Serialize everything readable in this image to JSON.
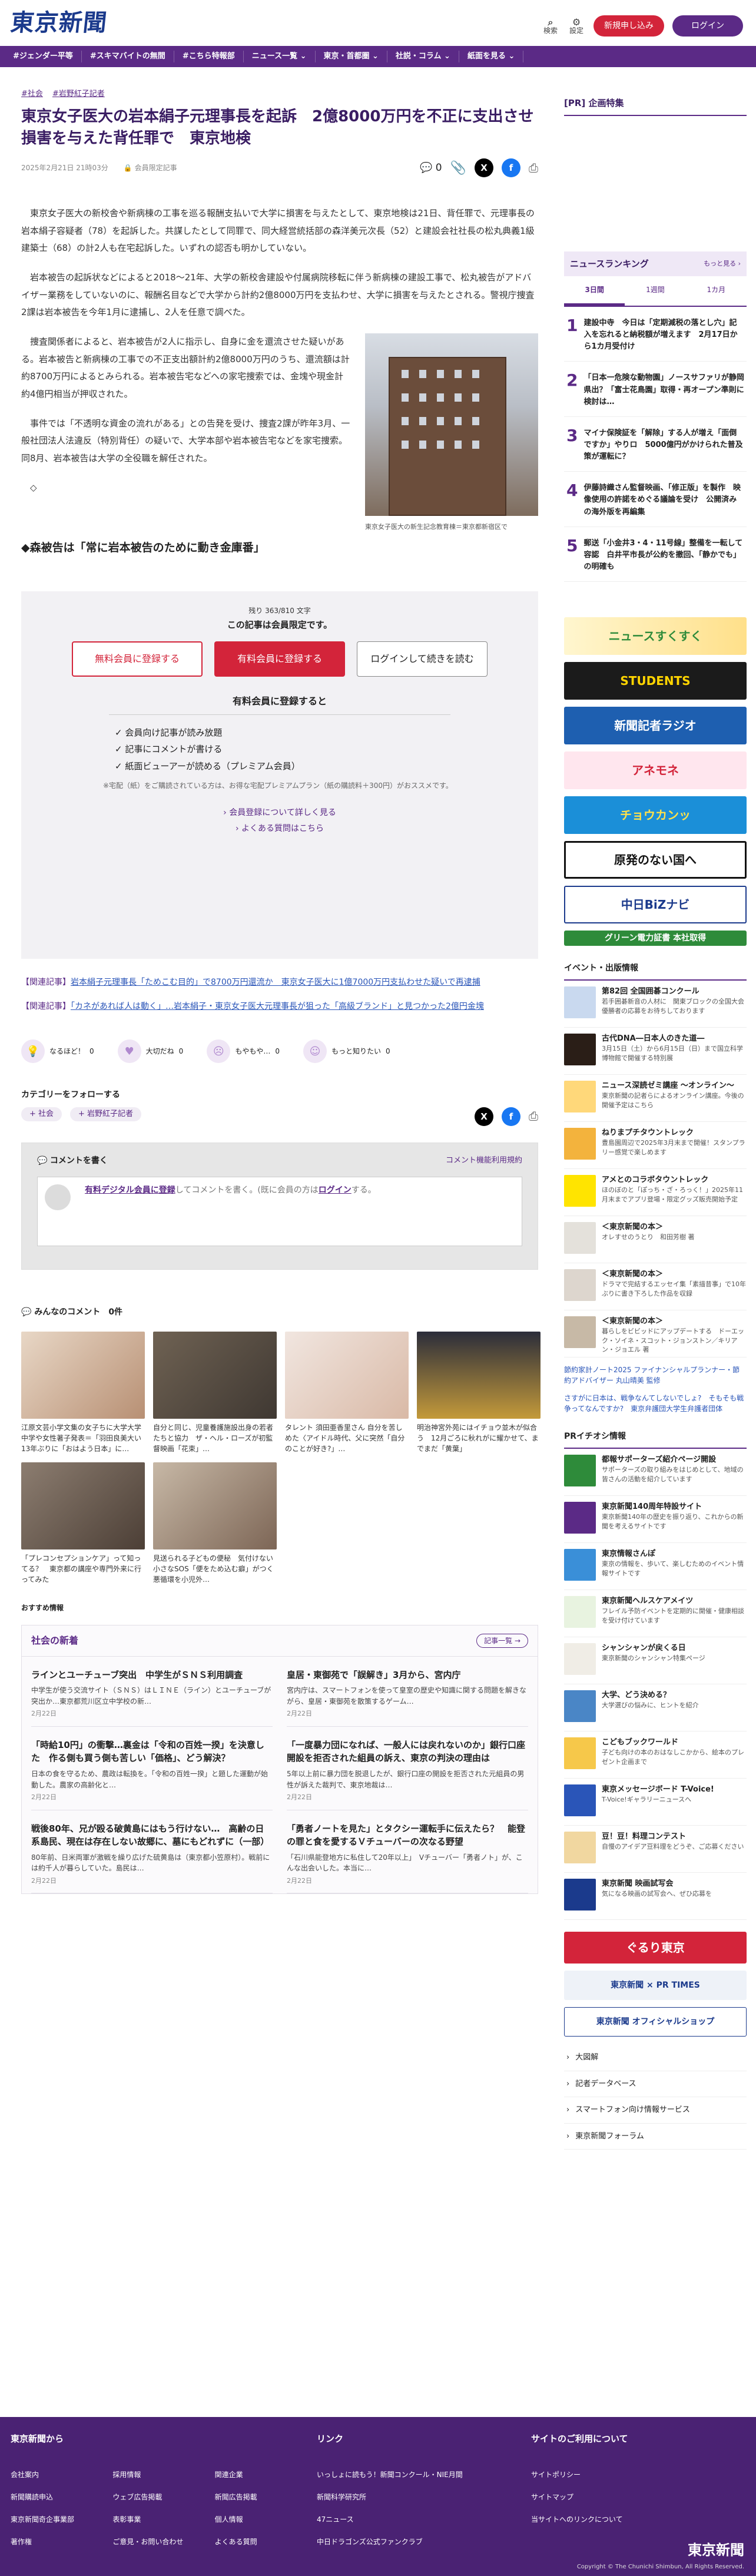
{
  "header": {
    "logo": "東京新聞",
    "search": "検索",
    "settings": "設定",
    "register": "新規申し込み",
    "login": "ログイン"
  },
  "nav": [
    "#ジェンダー平等",
    "#スキマバイトの無間",
    "#こちら特報部",
    "ニュース一覧 ⌄",
    "東京・首都圏 ⌄",
    "社説・コラム ⌄",
    "紙面を見る ⌄"
  ],
  "article": {
    "tags": [
      "#社会",
      "#岩野紅子記者"
    ],
    "title": "東京女子医大の岩本絹子元理事長を起訴　2億8000万円を不正に支出させ損害を与えた背任罪で　東京地検",
    "date": "2025年2月21日 21時03分",
    "author": "会員限定記事",
    "comment_count": "0",
    "paragraphs": [
      "東京女子医大の新校舎や新病棟の工事を巡る報酬支払いで大学に損害を与えたとして、東京地検は21日、背任罪で、元理事長の岩本絹子容疑者（78）を起訴した。共謀したとして同罪で、同大経営統括部の森洋美元次長（52）と建設会社社長の松丸典義1級建築士（68）の計2人も在宅起訴した。いずれの認否も明かしていない。",
      "岩本被告の起訴状などによると2018～21年、大学の新校舎建設や付属病院移転に伴う新病棟の建設工事で、松丸被告がアドバイザー業務をしていないのに、報酬名目などで大学から計約2億8000万円を支払わせ、大学に損害を与えたとされる。警視庁捜査2課は岩本被告を今年1月に逮捕し、2人を任意で調べた。",
      "捜査関係者によると、岩本被告が2人に指示し、自身に金を還流させた疑いがある。岩本被告と新病棟の工事での不正支出額計約2億8000万円のうち、還流額は計約8700万円によるとみられる。岩本被告宅などへの家宅捜索では、金塊や現金計約4億円相当が押収された。",
      "事件では「不透明な資金の流れがある」との告発を受け、捜査2課が昨年3月、一般社団法人法違反（特別背任）の疑いで、大学本部や岩本被告宅などを家宅捜索。同8月、岩本被告は大学の全役職を解任された。",
      "◇"
    ],
    "photo_caption": "東京女子医大の新生記念教育棟＝東京都新宿区で",
    "subheading": "◆森被告は「常に岩本被告のために動き金庫番」"
  },
  "paywall": {
    "remaining": "残り 363/810 文字",
    "notice": "この記事は会員限定です。",
    "free": "無料会員に登録する",
    "paid": "有料会員に登録する",
    "login": "ログインして続きを読む",
    "benefit_title": "有料会員に登録すると",
    "benefits": [
      "✓ 会員向け記事が読み放題",
      "✓ 記事にコメントが書ける",
      "✓ 紙面ビューアーが読める（プレミアム会員）"
    ],
    "note": "※宅配（紙）をご購読されている方は、お得な宅配プレミアムプラン（紙の購読料＋300円）がおススメです。",
    "link1": "会員登録について詳しく見る",
    "link2": "よくある質問はこちら"
  },
  "related": [
    {
      "label": "【関連記事】",
      "text": "岩本絹子元理事長「ためこむ目的」で8700万円還流か　東京女子医大に1億7000万円支払わせた疑いで再逮捕"
    },
    {
      "label": "【関連記事】",
      "text": "「カネがあれば人は動く」…岩本絹子・東京女子医大元理事長が狙った「高級ブランド」と見つかった2億円金塊"
    }
  ],
  "reactions": [
    "なるほど！",
    "大切だね",
    "もやもや…",
    "もっと知りたい"
  ],
  "reaction_counts": [
    "0",
    "0",
    "0",
    "0"
  ],
  "category": {
    "title": "カテゴリーをフォローする",
    "chips": [
      "+ 社会",
      "+ 岩野紅子記者"
    ]
  },
  "comment": {
    "title": "コメントを書く",
    "rules": "コメント機能利用規約",
    "prompt_link": "有料デジタル会員に登録",
    "prompt_text": "してコメントを書く。(既に会員の方は",
    "login": "ログイン",
    "prompt_end": "する。"
  },
  "everyone": {
    "title": "みんなのコメント",
    "count": "0件"
  },
  "grid": [
    "江原文芸小学文集の女子ちに大学大学中学や女性著子発表＝「羽田良美大い　13年ぶりに「おはよう日本」に…",
    "自分と同じ、児童養護施設出身の若者たちと協力　ザ・ヘル・ローズが初監督映画「花束」…",
    "タレント 須田亜香里さん 自分を苦しめた〈アイドル時代、父に突然「自分のことが好き?」…",
    "明治神宮外苑にはイチョウ並木が似合う　12月ごろに秋れがに耀かせて、までまだ「黄葉」",
    "「プレコンセプションケア」って知ってる？　東京都の講座や専門外来に行ってみた",
    "見送られる子どもの便秘　気付けない小さなSOS「便をため込む癖」がつく悪循環を小児外…"
  ],
  "recommend": "おすすめ情報",
  "social": {
    "title": "社会の新着",
    "more": "記事一覧 →",
    "items": [
      {
        "t": "ラインとユーチューブ突出　中学生がＳＮＳ利用調査",
        "p": "中学生が使う交流サイト（ＳＮＳ）はＬＩＮＥ（ライン）とユーチューブが突出か…東京都荒川区立中学校の新…",
        "d": "2月22日"
      },
      {
        "t": "皇居・東御苑で「誤解き」3月から、宮内庁",
        "p": "宮内庁は、スマートフォンを使って皇室の歴史や知識に関する問題を解きながら、皇居・東御苑を散策するゲーム…",
        "d": "2月22日"
      },
      {
        "t": "「時給10円」の衝撃…裏金は「令和の百姓一揆」を決意した　作る側も買う側も苦しい「価格」、どう解決？",
        "p": "日本の食を守るため、農政は転換を。「令和の百姓一揆」と題した運動が始動した。農家の高齢化と…",
        "d": "2月22日"
      },
      {
        "t": "「一度暴力団になれば、一般人には戻れないのか」銀行口座開設を拒否された組員の訴え、東京の判決の理由は",
        "p": "5年以上前に暴力団を脱退したが、銀行口座の開設を拒否された元組員の男性が訴えた裁判で、東京地裁は…",
        "d": "2月22日"
      },
      {
        "t": "戦後80年、兄が殴る破黄島にはもう行けない…　高齢の日系島民、現在は存在しない故郷に、墓にもどれずに（一部）",
        "p": "80年前、日米両軍が激戦を繰り広げた硫黄島は（東京都小笠原村）。戦前には約千人が暮らしていた。島民は…",
        "d": "2月22日"
      },
      {
        "t": "「勇者ノートを見た」とタクシー運転手に伝えたら？　能登の罪と食を愛するＶチューバーの次なる野望",
        "p": "「石川県能登地方に私住して20年以上」　Vチューバー「勇者ノト」が、こんな出会いした。本当に…",
        "d": "2月22日"
      }
    ]
  },
  "sidebar": {
    "pr": "[PR] 企画特集",
    "ranking_title": "ニュースランキング",
    "ranking_more": "もっと見る ›",
    "tabs": [
      "3日間",
      "1週間",
      "1カ月"
    ],
    "ranking": [
      "建設中寺　今日は「定期減税の落とし穴」記入を忘れると納税額が増えます　2月17日から1カ月受付け",
      "「日本一危険な動物園」ノースサファリが静岡県出？「富士花鳥園」取得・再オープン準則に検討は…",
      "マイナ保険証を「解除」する人が増え「面倒ですか」やりロ　5000億円がかけられた普及策が運転に？",
      "伊藤詩織さん監督映画、「修正版」を製作　映像使用の許諾をめぐる議論を受け　公開済みの海外版を再編集",
      "郵送「小金井3・4・11号線」整備を一転して容認　白井平市長が公約を撤回、「静かでも」の明確も"
    ],
    "banners": [
      "ニュースすくすく",
      "STUDENTS",
      "新聞記者ラジオ",
      "アネモネ",
      "チョウカンッ",
      "原発のない国へ",
      "中日BiZナビ",
      "グリーン電力証書 本社取得"
    ],
    "events_title": "イベント・出版情報",
    "events": [
      {
        "t": "第82回 全国囲碁コンクール",
        "s": "若手囲碁新音の人材に　関東ブロックの全国大会優勝者の応募をお待ちしております"
      },
      {
        "t": "古代DNA―日本人のきた道―",
        "s": "3月15日（土）から6月15日（日）まで国立科学博物館で開催する特別展"
      },
      {
        "t": "ニュース深読ゼミ講座 〜オンライン〜",
        "s": "東京新聞の記者らによるオンライン講座。今後の開催予定はこちら"
      },
      {
        "t": "ねりまプチタウントレック",
        "s": "豊島園周辺で2025年3月末まで開催！スタンプラリー感覚で楽しめます"
      },
      {
        "t": "アメとのコラボタウントレック",
        "s": "ほのぼのと「ぽっち・ざ・ろっく！」2025年11月末までアプリ登場・限定グッズ販売開始予定"
      },
      {
        "t": "＜東京新聞の本＞",
        "s": "オレすせのうとり　和田芳樹 著"
      },
      {
        "t": "＜東京新聞の本＞",
        "s": "ドラマで完結するエッセイ集「素描昔事」で10年ぶりに書き下ろした作品を収録"
      },
      {
        "t": "＜東京新聞の本＞",
        "s": "暮らしをビビッドにアップデートする　ドーエック・ソイネ・スコット・ジョンストン／キリアン・ジョエル 著"
      }
    ],
    "ptxts": [
      "節約家計ノート2025 ファイナンシャルプランナー・節約アドバイザー 丸山晴美 監修",
      "さすがに日本は、戦争なんてしないでしょ?　そもそも戦争ってなんですか?　東京弁護団大学生弁護者団体"
    ],
    "pr2_title": "PRイチオシ情報",
    "pr2": [
      {
        "t": "都報サポーターズ紹介ページ開設",
        "s": "サポーターズの取り組みをはじめとして、地域の皆さんの活動を紹介しています"
      },
      {
        "t": "東京新聞140周年特設サイト",
        "s": "東京新聞140年の歴史を振り返り、これからの新聞を考えるサイトです"
      },
      {
        "t": "東京情報さんぽ",
        "s": "東京の情報を、歩いて、楽しむためのイベント情報サイトです"
      },
      {
        "t": "東京新聞ヘルスケアメイツ",
        "s": "フレイル予防イベントを定期的に開催・健康相談を受け付けています"
      },
      {
        "t": "シャンシャンが戻くる日",
        "s": "東京新聞のシャンシャン特集ページ"
      },
      {
        "t": "大学、どう決める？",
        "s": "大学選びの悩みに、ヒントを紹介"
      },
      {
        "t": "こどもブックワールド",
        "s": "子ども向けの本のおはなしこかから、絵本のプレゼント企画まで"
      },
      {
        "t": "東京メッセージボード T-Voice!",
        "s": "T-Voice!ギャラリーニュースへ"
      },
      {
        "t": "豆！豆！料理コンテスト",
        "s": "自慢のアイデア豆料理をどうぞ、ご応募ください"
      },
      {
        "t": "東京新聞 映画試写会",
        "s": "気になる映画の試写会へ、ぜひ応募を"
      }
    ],
    "links": [
      "大図解",
      "記者データベース",
      "スマートフォン向け情報サービス",
      "東京新聞フォーラム"
    ]
  },
  "footer": {
    "title1": "東京新聞から",
    "title2": "リンク",
    "title3": "サイトのご利用について",
    "c1": [
      "会社案内",
      "採用情報",
      "関連企業",
      "新聞購読申込",
      "ウェブ広告掲載",
      "新聞広告掲載",
      "東京新聞奇企事業部",
      "表彰事業",
      "個人情報",
      "著作権",
      "ご意見・お問い合わせ",
      "よくある質問"
    ],
    "c2": [
      "いっしょに読もう！新聞コンクール・NIE月間",
      "新聞科学研究所",
      "47ニュース",
      "中日ドラゴンズ公式ファンクラブ"
    ],
    "c3": [
      "サイトポリシー",
      "サイトマップ",
      "当サイトへのリンクについて"
    ],
    "logo": "東京新聞",
    "copy": "Copyright © The Chunichi Shimbun, All Rights Reserved."
  },
  "colors": {
    "brand": "#5b2a86",
    "accent": "#d3243a",
    "logo": "#1b3a8c"
  }
}
